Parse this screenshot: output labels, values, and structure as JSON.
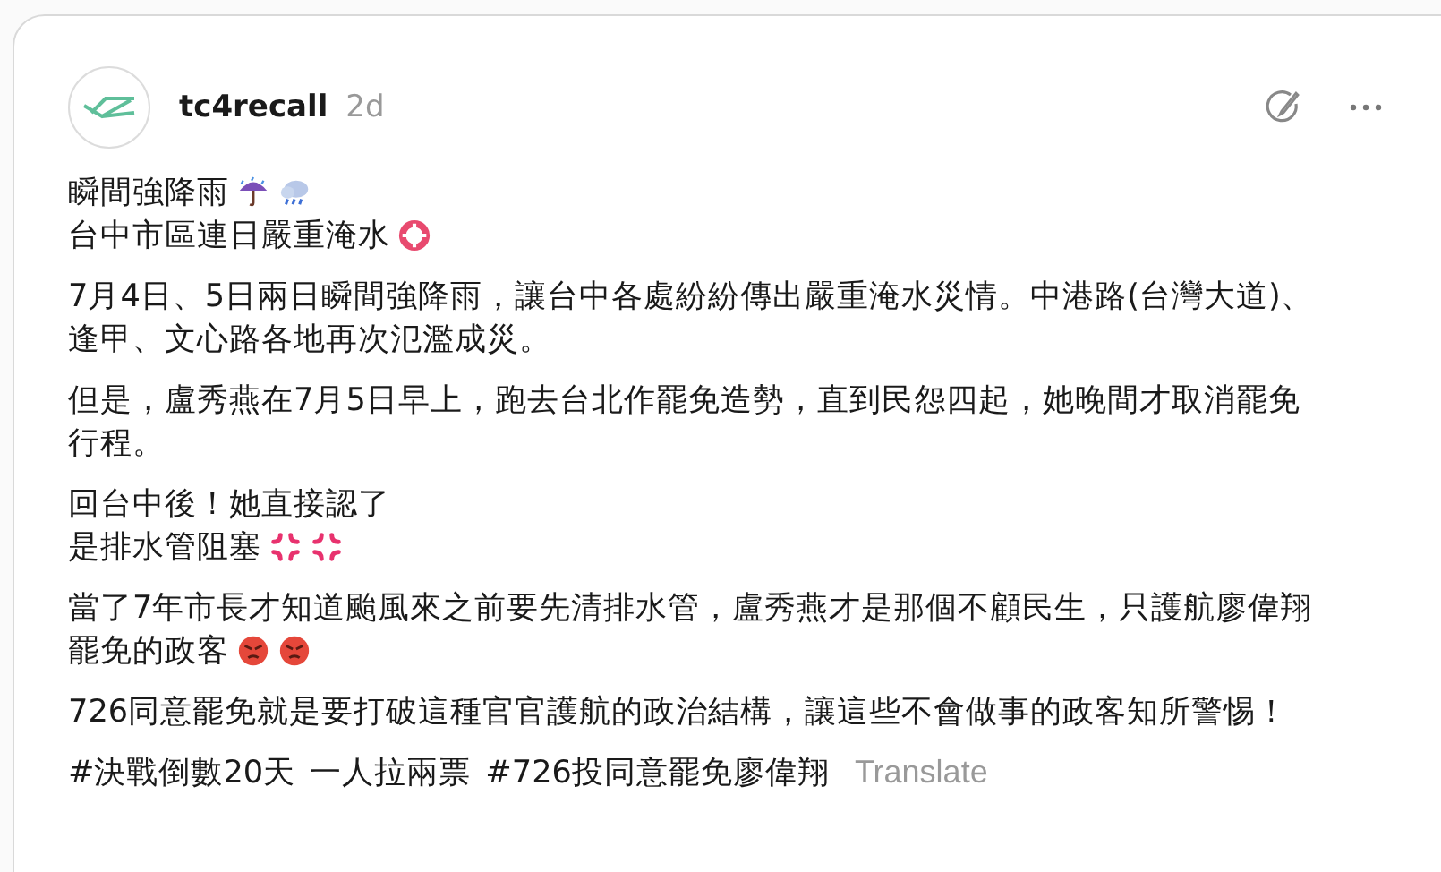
{
  "post": {
    "author": "tc4recall",
    "time": "2d",
    "paragraphs": [
      {
        "lines": [
          {
            "text": "瞬間強降雨",
            "emoji": [
              {
                "kind": "umbrella"
              },
              {
                "kind": "rain"
              }
            ]
          },
          {
            "text": "台中市區連日嚴重淹水",
            "emoji": [
              {
                "kind": "lifebuoy"
              }
            ]
          }
        ]
      },
      {
        "lines": [
          {
            "text": "7月4日、5日兩日瞬間強降雨，讓台中各處紛紛傳出嚴重淹水災情。中港路(台灣大道)、"
          },
          {
            "text": "逢甲、文心路各地再次氾濫成災。"
          }
        ]
      },
      {
        "lines": [
          {
            "text": "但是，盧秀燕在7月5日早上，跑去台北作罷免造勢，直到民怨四起，她晚間才取消罷免"
          },
          {
            "text": "行程。"
          }
        ]
      },
      {
        "lines": [
          {
            "text": "回台中後！她直接認了"
          },
          {
            "text": "是排水管阻塞",
            "emoji": [
              {
                "kind": "anger"
              },
              {
                "kind": "anger"
              }
            ]
          }
        ]
      },
      {
        "lines": [
          {
            "text": "當了7年市長才知道颱風來之前要先清排水管，盧秀燕才是那個不顧民生，只護航廖偉翔"
          },
          {
            "text": "罷免的政客",
            "emoji": [
              {
                "kind": "angry"
              },
              {
                "kind": "angry"
              }
            ]
          }
        ]
      },
      {
        "lines": [
          {
            "text": "726同意罷免就是要打破這種官官護航的政治結構，讓這些不會做事的政客知所警惕！"
          }
        ]
      }
    ],
    "tags": [
      "#決戰倒數20天",
      "一人拉兩票",
      "#726投同意罷免廖偉翔"
    ],
    "translate": "Translate"
  }
}
